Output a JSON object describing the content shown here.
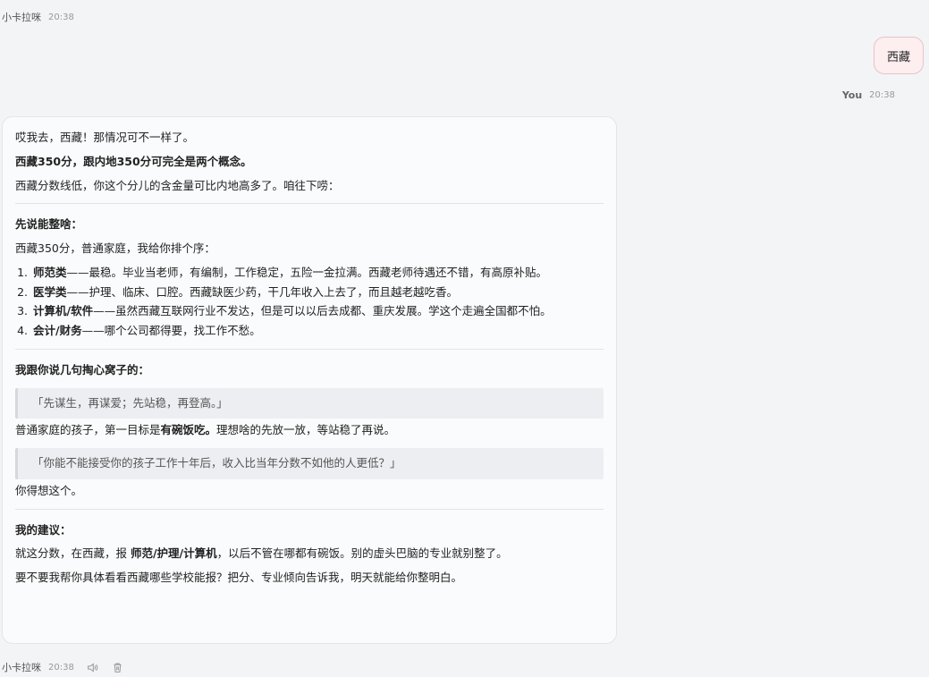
{
  "messages": {
    "bot_name": "小卡拉咪",
    "bot_time_top": "20:38",
    "user_text": "西藏",
    "user_name": "You",
    "user_time": "20:38",
    "bot_time_bottom": "20:38"
  },
  "reply": {
    "p1": "哎我去，西藏！那情况可不一样了。",
    "p2": "西藏350分，跟内地350分可完全是两个概念。",
    "p3": "西藏分数线低，你这个分儿的含金量可比内地高多了。咱往下唠：",
    "h1": "先说能整啥：",
    "p4": "西藏350分，普通家庭，我给你排个序：",
    "list": [
      {
        "bold": "师范类",
        "rest": "——最稳。毕业当老师，有编制，工作稳定，五险一金拉满。西藏老师待遇还不错，有高原补贴。"
      },
      {
        "bold": "医学类",
        "rest": "——护理、临床、口腔。西藏缺医少药，干几年收入上去了，而且越老越吃香。"
      },
      {
        "bold": "计算机/软件",
        "rest": "——虽然西藏互联网行业不发达，但是可以以后去成都、重庆发展。学这个走遍全国都不怕。"
      },
      {
        "bold": "会计/财务",
        "rest": "——哪个公司都得要，找工作不愁。"
      }
    ],
    "h2": "我跟你说几句掏心窝子的：",
    "quote1": "「先谋生，再谋爱；先站稳，再登高。」",
    "p5_a": "普通家庭的孩子，第一目标是",
    "p5_b": "有碗饭吃。",
    "p5_c": "理想啥的先放一放，等站稳了再说。",
    "quote2": "「你能不能接受你的孩子工作十年后，收入比当年分数不如他的人更低？」",
    "p6": "你得想这个。",
    "h3": "我的建议：",
    "p7_a": "就这分数，在西藏，报 ",
    "p7_b": "师范/护理/计算机",
    "p7_c": "，以后不管在哪都有碗饭。别的虚头巴脑的专业就别整了。",
    "p8": "要不要我帮你具体看看西藏哪些学校能报？把分、专业倾向告诉我，明天就能给你整明白。"
  },
  "icons": {
    "speaker": "speaker-icon",
    "trash": "trash-icon"
  }
}
